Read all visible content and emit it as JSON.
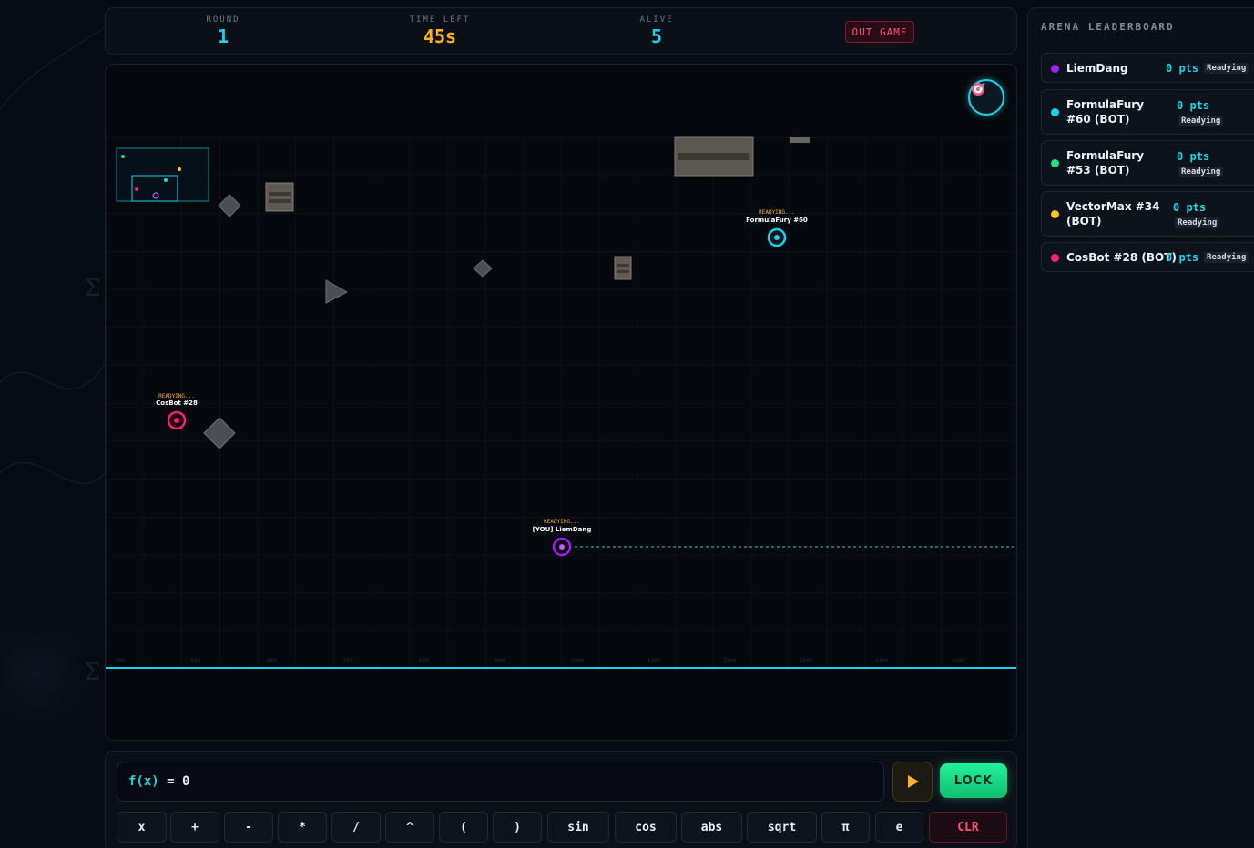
{
  "stats": {
    "round_label": "ROUND",
    "round_value": "1",
    "time_label": "TIME LEFT",
    "time_value": "45s",
    "alive_label": "ALIVE",
    "alive_value": "5",
    "out_label": "OUT GAME"
  },
  "colors": {
    "accent": "#19d3e8",
    "time": "#ffb020",
    "danger": "#ff4f7b",
    "lock": "#22f09a"
  },
  "players": [
    {
      "name": "LiemDang",
      "label": "[YOU] LiemDang",
      "status": "READYING...",
      "color": "#a020f0"
    },
    {
      "name": "FormulaFury #60",
      "label": "FormulaFury #60",
      "status": "READYING...",
      "color": "#19d3e8"
    },
    {
      "name": "CosBot #28",
      "label": "CosBot #28",
      "status": "READYING...",
      "color": "#ff1f75"
    }
  ],
  "axis_ticks": [
    "100",
    "150",
    "600",
    "700",
    "800",
    "900",
    "1000",
    "1100",
    "1200",
    "1300",
    "1400",
    "1500"
  ],
  "leaderboard": {
    "title": "ARENA LEADERBOARD",
    "rows": [
      {
        "name": "LiemDang",
        "pts": "0 pts",
        "status": "Readying",
        "color": "#a020f0"
      },
      {
        "name": "FormulaFury #60 (BOT)",
        "pts": "0 pts",
        "status": "Readying",
        "color": "#19d3e8"
      },
      {
        "name": "FormulaFury #53 (BOT)",
        "pts": "0 pts",
        "status": "Readying",
        "color": "#22e07a"
      },
      {
        "name": "VectorMax #34 (BOT)",
        "pts": "0 pts",
        "status": "Readying",
        "color": "#ffc21a"
      },
      {
        "name": "CosBot #28 (BOT)",
        "pts": "0 pts",
        "status": "Readying",
        "color": "#ff1f75"
      }
    ]
  },
  "formula": {
    "prefix": "f(x)",
    "expression": " = 0",
    "lock_label": "LOCK",
    "keys": [
      "x",
      "+",
      "-",
      "*",
      "/",
      "^",
      "(",
      ")",
      "sin",
      "cos",
      "abs",
      "sqrt",
      "π",
      "e",
      "CLR"
    ]
  }
}
